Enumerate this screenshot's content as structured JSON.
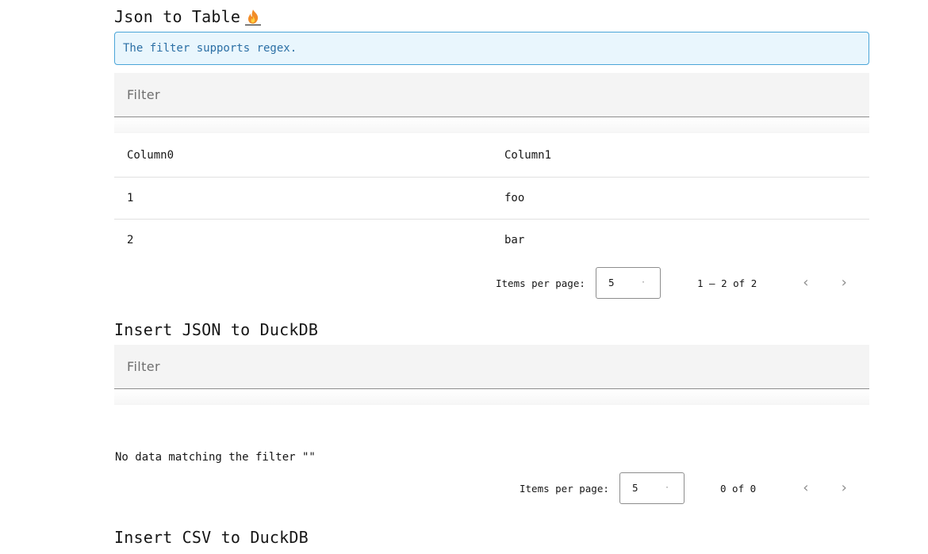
{
  "section1": {
    "title": "Json to Table",
    "notice": "The filter supports regex.",
    "filter_placeholder": "Filter",
    "columns": [
      "Column0",
      "Column1"
    ],
    "rows": [
      [
        "1",
        "foo"
      ],
      [
        "2",
        "bar"
      ]
    ],
    "pagination": {
      "items_per_page_label": "Items per page:",
      "items_per_page": "5",
      "range": "1 – 2 of 2"
    }
  },
  "section2": {
    "title": "Insert JSON to DuckDB",
    "filter_placeholder": "Filter",
    "empty_message": "No data matching the filter \"\"",
    "pagination": {
      "items_per_page_label": "Items per page:",
      "items_per_page": "5",
      "range": "0 of 0"
    }
  },
  "section3": {
    "title": "Insert CSV to DuckDB"
  },
  "icons": {
    "title_icon": "flame-icon",
    "select_caret": "caret-down-icon",
    "prev": "chevron-left-icon",
    "next": "chevron-right-icon"
  },
  "colors": {
    "notice_border": "#4ba5d8",
    "notice_bg": "#e9f6fd",
    "notice_text": "#2b6fa5"
  }
}
